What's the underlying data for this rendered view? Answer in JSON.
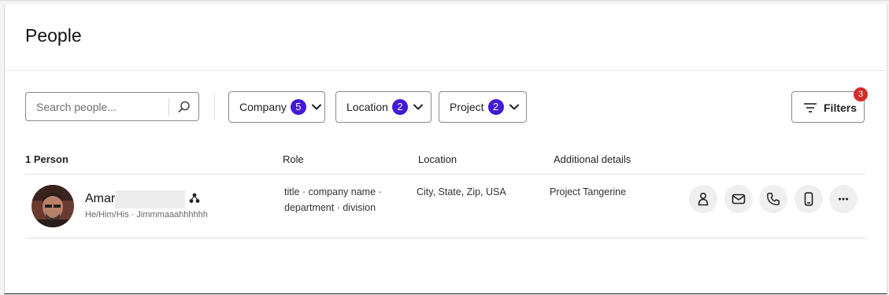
{
  "page": {
    "title": "People"
  },
  "search": {
    "placeholder": "Search people..."
  },
  "filters": {
    "chips": [
      {
        "label": "Company",
        "count": "5"
      },
      {
        "label": "Location",
        "count": "2"
      },
      {
        "label": "Project",
        "count": "2"
      }
    ],
    "button_label": "Filters",
    "active_count": "3"
  },
  "table": {
    "columns": {
      "people": "1 Person",
      "role": "Role",
      "location": "Location",
      "details": "Additional details"
    },
    "rows": [
      {
        "name": "Amar",
        "pronouns": "He/Him/His · Jimmmaaahhhhhh",
        "role_line1": "title · company name ·",
        "role_line2": "department · division",
        "location": "City, State, Zip, USA",
        "details": "Project Tangerine"
      }
    ]
  },
  "actions": [
    "profile-icon",
    "mail-icon",
    "phone-icon",
    "mobile-icon",
    "more-icon"
  ],
  "colors": {
    "accent": "#4319d6",
    "alert": "#d42b2b"
  }
}
